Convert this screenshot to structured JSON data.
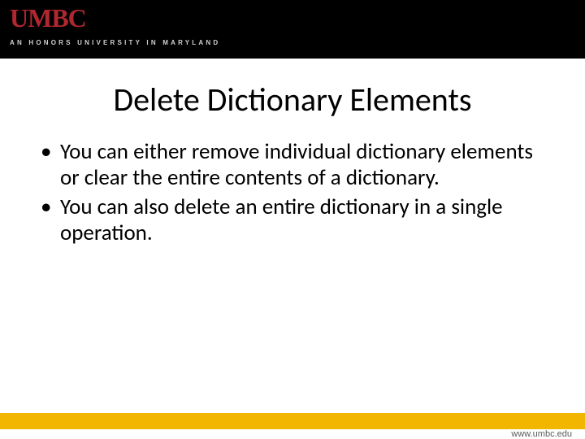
{
  "header": {
    "logo_main": "UMBC",
    "logo_tagline": "AN HONORS UNIVERSITY IN MARYLAND"
  },
  "title": "Delete Dictionary Elements",
  "bullets": [
    "You can either remove individual dictionary elements or clear the entire contents of a dictionary.",
    "You can also delete an entire dictionary in a single operation."
  ],
  "footer": {
    "url": "www.umbc.edu"
  }
}
